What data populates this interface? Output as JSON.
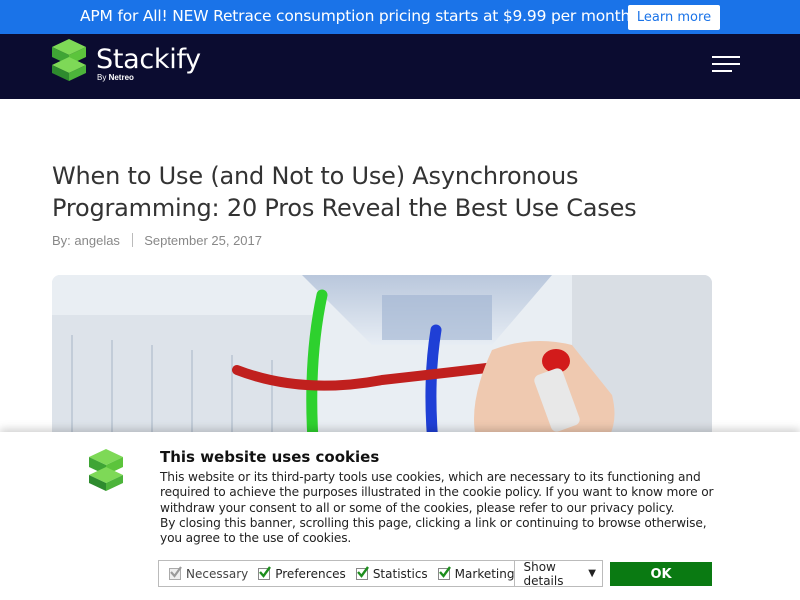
{
  "promo": {
    "text": "APM for All! NEW Retrace consumption pricing starts at $9.99 per month!",
    "button": "Learn more"
  },
  "header": {
    "brand": "Stackify",
    "by": "By",
    "parent": "Netreo",
    "menu_icon": "hamburger-icon"
  },
  "article": {
    "title": "When to Use (and Not to Use) Asynchronous Programming: 20 Pros Reveal the Best Use Cases",
    "author": "By: angelas",
    "date": "September 25, 2017"
  },
  "cookie": {
    "title": "This website uses cookies",
    "paragraph1": "This website or its third-party tools use cookies, which are necessary to its functioning and required to achieve the purposes illustrated in the cookie policy. If you want to know more or withdraw your consent to all or some of the cookies, please refer to our privacy policy.",
    "paragraph2": "By closing this banner, scrolling this page, clicking a link or continuing to browse otherwise, you agree to the use of cookies.",
    "options": [
      {
        "label": "Necessary",
        "checked": true,
        "disabled": true
      },
      {
        "label": "Preferences",
        "checked": true,
        "disabled": false
      },
      {
        "label": "Statistics",
        "checked": true,
        "disabled": false
      },
      {
        "label": "Marketing",
        "checked": true,
        "disabled": false
      }
    ],
    "details": "Show details",
    "ok": "OK"
  },
  "colors": {
    "promo_bg": "#1a73e8",
    "header_bg": "#0b0c30",
    "ok_bg": "#0a7a12",
    "check_green": "#1e8e1e",
    "logo_green": "#5cc43c"
  }
}
